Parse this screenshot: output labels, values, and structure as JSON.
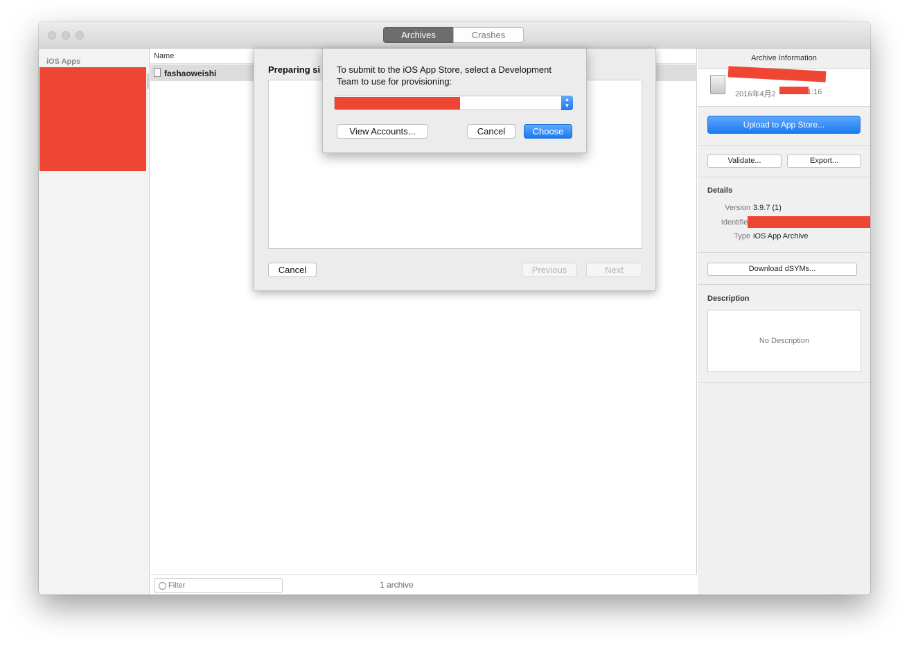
{
  "toolbar": {
    "tabs": [
      {
        "label": "Archives",
        "selected": true
      },
      {
        "label": "Crashes",
        "selected": false
      }
    ]
  },
  "sidebar": {
    "header": "iOS Apps"
  },
  "list": {
    "column_name": "Name",
    "rows": [
      {
        "name": "fashaoweishi"
      }
    ],
    "filter_placeholder": "Filter",
    "count": "1 archive"
  },
  "sheet": {
    "title": "Preparing si",
    "cancel_label": "Cancel",
    "previous_label": "Previous",
    "next_label": "Next"
  },
  "dialog": {
    "message": "To submit to the iOS App Store, select a Development Team to use for provisioning:",
    "view_accounts_label": "View Accounts...",
    "cancel_label": "Cancel",
    "choose_label": "Choose"
  },
  "inspector": {
    "title": "Archive Information",
    "archive_date": "2016年4月2",
    "archive_time": "1:16",
    "upload_label": "Upload to App Store...",
    "validate_label": "Validate...",
    "export_label": "Export...",
    "details_header": "Details",
    "details": {
      "version_label": "Version",
      "version_value": "3.9.7 (1)",
      "identifier_label": "Identifier",
      "type_label": "Type",
      "type_value": "iOS App Archive"
    },
    "dsyms_label": "Download dSYMs...",
    "description_header": "Description",
    "description_text": "No Description"
  },
  "colors": {
    "accent": "#1b7af0",
    "redaction": "#ef4634"
  }
}
